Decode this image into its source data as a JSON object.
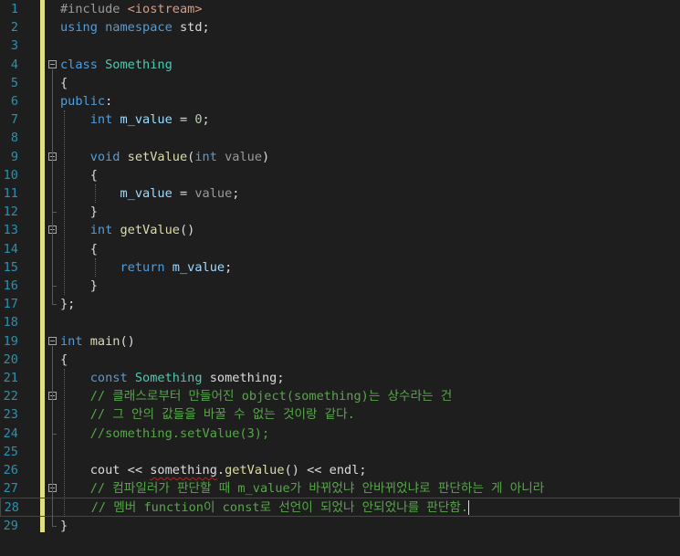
{
  "editor": {
    "lines": [
      {
        "n": "1",
        "segs": [
          [
            "pp",
            "#include "
          ],
          [
            "inc",
            "<iostream>"
          ]
        ]
      },
      {
        "n": "2",
        "segs": [
          [
            "kw",
            "using namespace "
          ],
          [
            "pl",
            "std;"
          ]
        ]
      },
      {
        "n": "3",
        "segs": []
      },
      {
        "n": "4",
        "fold": true,
        "segs": [
          [
            "kw",
            "class "
          ],
          [
            "ty",
            "Something"
          ]
        ]
      },
      {
        "n": "5",
        "segs": [
          [
            "pl",
            "{"
          ]
        ]
      },
      {
        "n": "6",
        "segs": [
          [
            "kw",
            "public"
          ],
          [
            "pl",
            ":"
          ]
        ]
      },
      {
        "n": "7",
        "segs": [
          [
            "pl",
            "    "
          ],
          [
            "kw",
            "int "
          ],
          [
            "pr",
            "m_value"
          ],
          [
            "pl",
            " = "
          ],
          [
            "num",
            "0"
          ],
          [
            "pl",
            ";"
          ]
        ]
      },
      {
        "n": "8",
        "segs": []
      },
      {
        "n": "9",
        "fold": true,
        "segs": [
          [
            "pl",
            "    "
          ],
          [
            "kw",
            "void "
          ],
          [
            "fn",
            "setValue"
          ],
          [
            "pl",
            "("
          ],
          [
            "kw",
            "int "
          ],
          [
            "pa",
            "value"
          ],
          [
            "pl",
            ")"
          ]
        ]
      },
      {
        "n": "10",
        "segs": [
          [
            "pl",
            "    {"
          ]
        ]
      },
      {
        "n": "11",
        "segs": [
          [
            "pl",
            "        "
          ],
          [
            "pr",
            "m_value"
          ],
          [
            "pl",
            " = "
          ],
          [
            "pa",
            "value"
          ],
          [
            "pl",
            ";"
          ]
        ]
      },
      {
        "n": "12",
        "segs": [
          [
            "pl",
            "    }"
          ]
        ]
      },
      {
        "n": "13",
        "fold": true,
        "segs": [
          [
            "pl",
            "    "
          ],
          [
            "kw",
            "int "
          ],
          [
            "fn",
            "getValue"
          ],
          [
            "pl",
            "()"
          ]
        ]
      },
      {
        "n": "14",
        "segs": [
          [
            "pl",
            "    {"
          ]
        ]
      },
      {
        "n": "15",
        "segs": [
          [
            "pl",
            "        "
          ],
          [
            "kw",
            "return "
          ],
          [
            "pr",
            "m_value"
          ],
          [
            "pl",
            ";"
          ]
        ]
      },
      {
        "n": "16",
        "segs": [
          [
            "pl",
            "    }"
          ]
        ]
      },
      {
        "n": "17",
        "segs": [
          [
            "pl",
            "};"
          ]
        ]
      },
      {
        "n": "18",
        "segs": []
      },
      {
        "n": "19",
        "fold": true,
        "segs": [
          [
            "kw",
            "int "
          ],
          [
            "fn",
            "main"
          ],
          [
            "pl",
            "()"
          ]
        ]
      },
      {
        "n": "20",
        "segs": [
          [
            "pl",
            "{"
          ]
        ]
      },
      {
        "n": "21",
        "segs": [
          [
            "pl",
            "    "
          ],
          [
            "kw",
            "const "
          ],
          [
            "ty",
            "Something "
          ],
          [
            "vr",
            "something"
          ],
          [
            "pl",
            ";"
          ]
        ]
      },
      {
        "n": "22",
        "fold": true,
        "segs": [
          [
            "pl",
            "    "
          ],
          [
            "cm",
            "// 클래스로부터 만들어진 object(something)는 상수라는 건"
          ]
        ]
      },
      {
        "n": "23",
        "segs": [
          [
            "pl",
            "    "
          ],
          [
            "cm",
            "// 그 안의 값들을 바꿀 수 없는 것이랑 같다."
          ]
        ]
      },
      {
        "n": "24",
        "segs": [
          [
            "pl",
            "    "
          ],
          [
            "cm",
            "//something.setValue(3);"
          ]
        ]
      },
      {
        "n": "25",
        "segs": []
      },
      {
        "n": "26",
        "segs": [
          [
            "pl",
            "    cout << "
          ],
          [
            "vr squig",
            "something"
          ],
          [
            "pl",
            "."
          ],
          [
            "fn",
            "getValue"
          ],
          [
            "pl",
            "() << endl;"
          ]
        ]
      },
      {
        "n": "27",
        "fold": true,
        "segs": [
          [
            "pl",
            "    "
          ],
          [
            "cm",
            "// 컴파일러가 판단할 때 m_value가 바뀌었냐 안바뀌었냐로 판단하는 게 아니라"
          ]
        ]
      },
      {
        "n": "28",
        "current": true,
        "segs": [
          [
            "pl",
            "    "
          ],
          [
            "cm",
            "// 멤버 function이 const로 선언이 되었나 안되었나를 판단함."
          ]
        ]
      },
      {
        "n": "29",
        "segs": [
          [
            "pl",
            "}"
          ]
        ]
      }
    ]
  }
}
